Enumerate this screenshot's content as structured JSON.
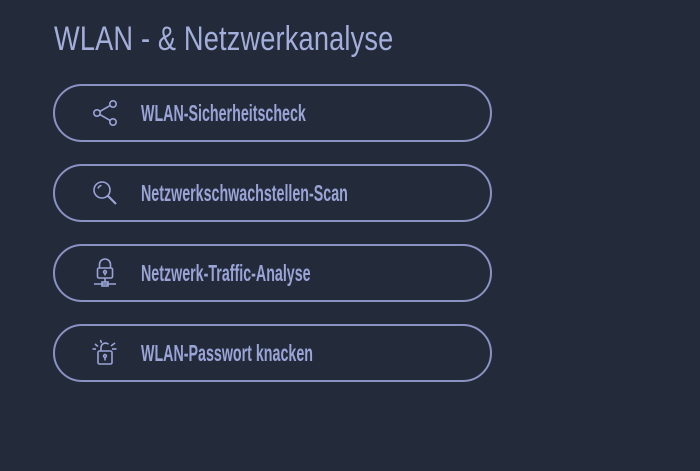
{
  "page": {
    "title": "WLAN - & Netzwerkanalyse"
  },
  "menu": {
    "items": [
      {
        "label": "WLAN-Sicherheitscheck",
        "icon": "share-icon"
      },
      {
        "label": "Netzwerkschwachstellen-Scan",
        "icon": "search-icon"
      },
      {
        "label": "Netzwerk-Traffic-Analyse",
        "icon": "network-lock-icon"
      },
      {
        "label": "WLAN-Passwort knacken",
        "icon": "unlock-icon"
      }
    ]
  },
  "colors": {
    "background": "#232a3a",
    "title": "#a4aedb",
    "button_border": "#8a92c2",
    "button_text": "#9aa4d6"
  }
}
